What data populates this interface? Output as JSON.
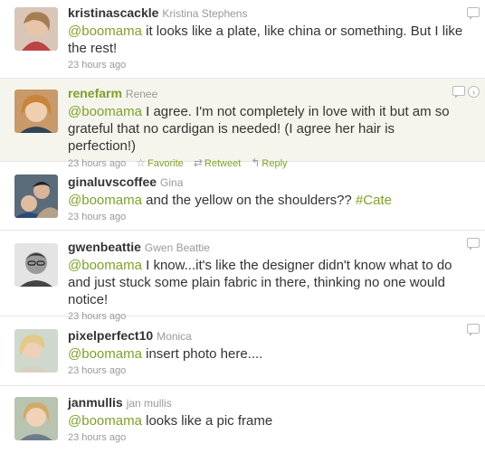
{
  "tweets": [
    {
      "screen_name": "kristinascackle",
      "real_name": "Kristina Stephens",
      "mention": "@boomama",
      "text": " it looks like a plate, like china or something. But I like the rest!",
      "time": "23 hours ago"
    },
    {
      "screen_name": "renefarm",
      "real_name": "Renee",
      "mention": "@boomama",
      "text": " I agree. I'm not completely in love with it but am so grateful that no cardigan is needed! (I agree her hair is perfection!)",
      "time": "23 hours ago",
      "actions": {
        "favorite": "Favorite",
        "retweet": "Retweet",
        "reply": "Reply"
      }
    },
    {
      "screen_name": "ginaluvscoffee",
      "real_name": "Gina",
      "mention": "@boomama",
      "text": " and the yellow on the shoulders?? ",
      "hashtag": "#Cate",
      "time": "23 hours ago"
    },
    {
      "screen_name": "gwenbeattie",
      "real_name": "Gwen Beattie",
      "mention": "@boomama",
      "text": " I know...it's like the designer didn't know what to do and just stuck some plain fabric in there, thinking no one would notice!",
      "time": "23 hours ago"
    },
    {
      "screen_name": "pixelperfect10",
      "real_name": "Monica",
      "mention": "@boomama",
      "text": " insert photo here....",
      "time": "23 hours ago"
    },
    {
      "screen_name": "janmullis",
      "real_name": "jan mullis",
      "mention": "@boomama",
      "text": " looks like a pic frame",
      "time": "23 hours ago"
    }
  ],
  "icons": {
    "reply_bubble": "speech-bubble-icon",
    "more": "chevron-right-circle-icon",
    "favorite": "star-icon",
    "retweet": "retweet-icon",
    "reply": "reply-arrow-icon"
  },
  "colors": {
    "link": "#7fa02a",
    "highlight_bg": "#f5f5ee",
    "meta": "#999999"
  }
}
